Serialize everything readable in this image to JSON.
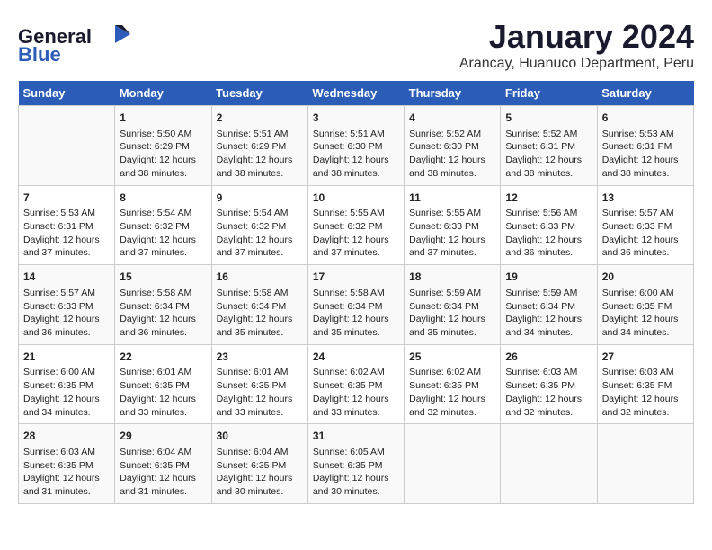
{
  "header": {
    "logo_general": "General",
    "logo_blue": "Blue",
    "title": "January 2024",
    "subtitle": "Arancay, Huanuco Department, Peru"
  },
  "weekdays": [
    "Sunday",
    "Monday",
    "Tuesday",
    "Wednesday",
    "Thursday",
    "Friday",
    "Saturday"
  ],
  "weeks": [
    [
      {
        "day": "",
        "content": ""
      },
      {
        "day": "1",
        "content": "Sunrise: 5:50 AM\nSunset: 6:29 PM\nDaylight: 12 hours\nand 38 minutes."
      },
      {
        "day": "2",
        "content": "Sunrise: 5:51 AM\nSunset: 6:29 PM\nDaylight: 12 hours\nand 38 minutes."
      },
      {
        "day": "3",
        "content": "Sunrise: 5:51 AM\nSunset: 6:30 PM\nDaylight: 12 hours\nand 38 minutes."
      },
      {
        "day": "4",
        "content": "Sunrise: 5:52 AM\nSunset: 6:30 PM\nDaylight: 12 hours\nand 38 minutes."
      },
      {
        "day": "5",
        "content": "Sunrise: 5:52 AM\nSunset: 6:31 PM\nDaylight: 12 hours\nand 38 minutes."
      },
      {
        "day": "6",
        "content": "Sunrise: 5:53 AM\nSunset: 6:31 PM\nDaylight: 12 hours\nand 38 minutes."
      }
    ],
    [
      {
        "day": "7",
        "content": "Sunrise: 5:53 AM\nSunset: 6:31 PM\nDaylight: 12 hours\nand 37 minutes."
      },
      {
        "day": "8",
        "content": "Sunrise: 5:54 AM\nSunset: 6:32 PM\nDaylight: 12 hours\nand 37 minutes."
      },
      {
        "day": "9",
        "content": "Sunrise: 5:54 AM\nSunset: 6:32 PM\nDaylight: 12 hours\nand 37 minutes."
      },
      {
        "day": "10",
        "content": "Sunrise: 5:55 AM\nSunset: 6:32 PM\nDaylight: 12 hours\nand 37 minutes."
      },
      {
        "day": "11",
        "content": "Sunrise: 5:55 AM\nSunset: 6:33 PM\nDaylight: 12 hours\nand 37 minutes."
      },
      {
        "day": "12",
        "content": "Sunrise: 5:56 AM\nSunset: 6:33 PM\nDaylight: 12 hours\nand 36 minutes."
      },
      {
        "day": "13",
        "content": "Sunrise: 5:57 AM\nSunset: 6:33 PM\nDaylight: 12 hours\nand 36 minutes."
      }
    ],
    [
      {
        "day": "14",
        "content": "Sunrise: 5:57 AM\nSunset: 6:33 PM\nDaylight: 12 hours\nand 36 minutes."
      },
      {
        "day": "15",
        "content": "Sunrise: 5:58 AM\nSunset: 6:34 PM\nDaylight: 12 hours\nand 36 minutes."
      },
      {
        "day": "16",
        "content": "Sunrise: 5:58 AM\nSunset: 6:34 PM\nDaylight: 12 hours\nand 35 minutes."
      },
      {
        "day": "17",
        "content": "Sunrise: 5:58 AM\nSunset: 6:34 PM\nDaylight: 12 hours\nand 35 minutes."
      },
      {
        "day": "18",
        "content": "Sunrise: 5:59 AM\nSunset: 6:34 PM\nDaylight: 12 hours\nand 35 minutes."
      },
      {
        "day": "19",
        "content": "Sunrise: 5:59 AM\nSunset: 6:34 PM\nDaylight: 12 hours\nand 34 minutes."
      },
      {
        "day": "20",
        "content": "Sunrise: 6:00 AM\nSunset: 6:35 PM\nDaylight: 12 hours\nand 34 minutes."
      }
    ],
    [
      {
        "day": "21",
        "content": "Sunrise: 6:00 AM\nSunset: 6:35 PM\nDaylight: 12 hours\nand 34 minutes."
      },
      {
        "day": "22",
        "content": "Sunrise: 6:01 AM\nSunset: 6:35 PM\nDaylight: 12 hours\nand 33 minutes."
      },
      {
        "day": "23",
        "content": "Sunrise: 6:01 AM\nSunset: 6:35 PM\nDaylight: 12 hours\nand 33 minutes."
      },
      {
        "day": "24",
        "content": "Sunrise: 6:02 AM\nSunset: 6:35 PM\nDaylight: 12 hours\nand 33 minutes."
      },
      {
        "day": "25",
        "content": "Sunrise: 6:02 AM\nSunset: 6:35 PM\nDaylight: 12 hours\nand 32 minutes."
      },
      {
        "day": "26",
        "content": "Sunrise: 6:03 AM\nSunset: 6:35 PM\nDaylight: 12 hours\nand 32 minutes."
      },
      {
        "day": "27",
        "content": "Sunrise: 6:03 AM\nSunset: 6:35 PM\nDaylight: 12 hours\nand 32 minutes."
      }
    ],
    [
      {
        "day": "28",
        "content": "Sunrise: 6:03 AM\nSunset: 6:35 PM\nDaylight: 12 hours\nand 31 minutes."
      },
      {
        "day": "29",
        "content": "Sunrise: 6:04 AM\nSunset: 6:35 PM\nDaylight: 12 hours\nand 31 minutes."
      },
      {
        "day": "30",
        "content": "Sunrise: 6:04 AM\nSunset: 6:35 PM\nDaylight: 12 hours\nand 30 minutes."
      },
      {
        "day": "31",
        "content": "Sunrise: 6:05 AM\nSunset: 6:35 PM\nDaylight: 12 hours\nand 30 minutes."
      },
      {
        "day": "",
        "content": ""
      },
      {
        "day": "",
        "content": ""
      },
      {
        "day": "",
        "content": ""
      }
    ]
  ]
}
